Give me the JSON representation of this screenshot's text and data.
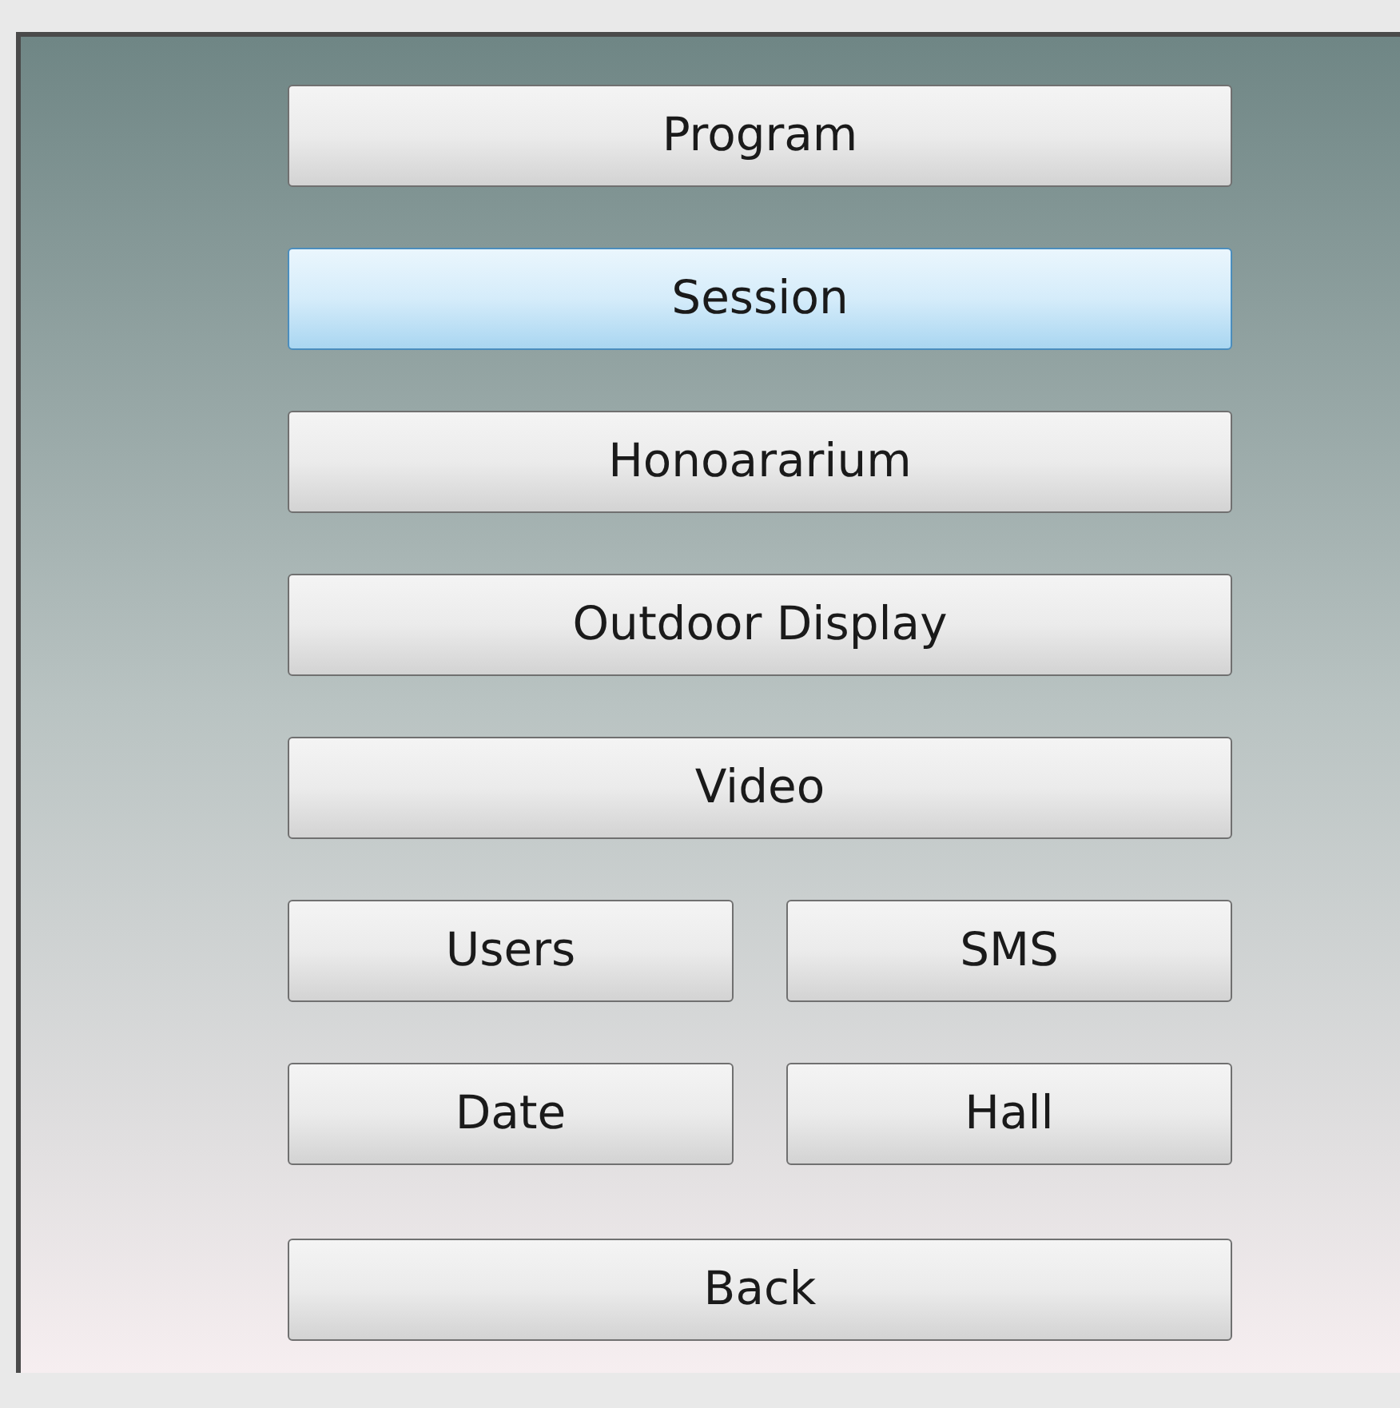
{
  "buttons": [
    {
      "label": "Program",
      "kind": "wide",
      "selected": false
    },
    {
      "label": "Session",
      "kind": "wide",
      "selected": true
    },
    {
      "label": "Honoararium",
      "kind": "wide",
      "selected": false
    },
    {
      "label": "Outdoor Display",
      "kind": "wide",
      "selected": false
    },
    {
      "label": "Video",
      "kind": "wide",
      "selected": false
    },
    {
      "label": "Users",
      "kind": "half",
      "selected": false
    },
    {
      "label": "SMS",
      "kind": "half",
      "selected": false
    },
    {
      "label": "Date",
      "kind": "half",
      "selected": false
    },
    {
      "label": "Hall",
      "kind": "half",
      "selected": false
    },
    {
      "label": "Back",
      "kind": "wide",
      "selected": false
    }
  ]
}
